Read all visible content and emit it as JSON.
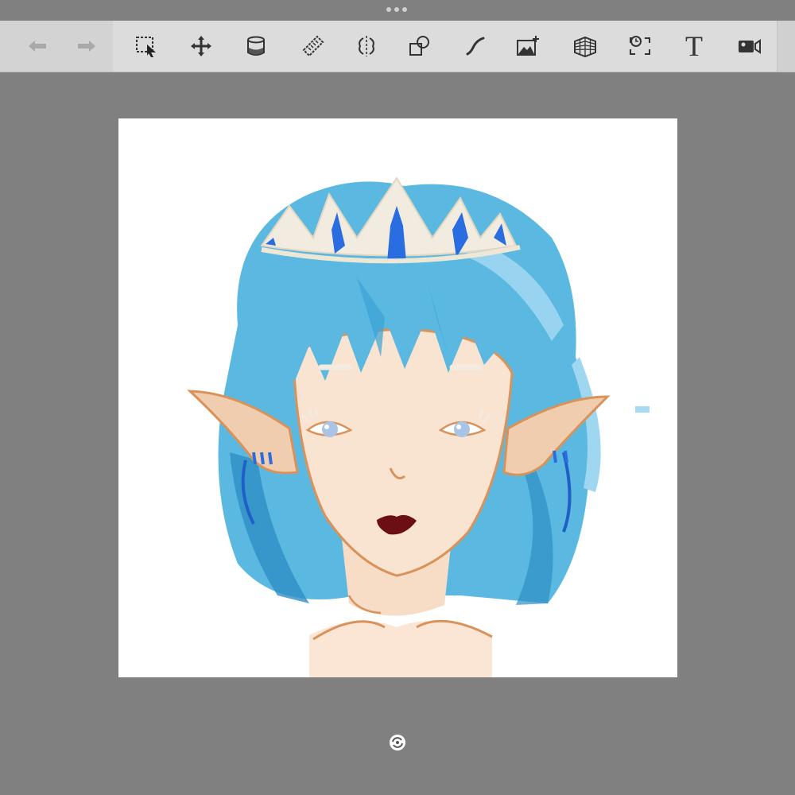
{
  "toolbar": {
    "tools": [
      {
        "name": "undo-icon"
      },
      {
        "name": "redo-icon"
      },
      {
        "name": "selection-icon"
      },
      {
        "name": "transform-icon"
      },
      {
        "name": "fill-bucket-icon"
      },
      {
        "name": "ruler-icon"
      },
      {
        "name": "symmetry-icon"
      },
      {
        "name": "shapes-icon"
      },
      {
        "name": "curve-icon"
      },
      {
        "name": "insert-image-icon"
      },
      {
        "name": "perspective-guide-icon"
      },
      {
        "name": "timelapse-icon"
      },
      {
        "name": "text-icon"
      },
      {
        "name": "record-video-icon"
      }
    ],
    "text_tool_glyph": "T"
  },
  "canvas": {
    "background": "#ffffff",
    "artwork": "elf-girl-portrait-icon",
    "colors": {
      "hair": "#5bb8e0",
      "hair_dark": "#2f8fc4",
      "skin": "#f7dcc6",
      "skin_outline": "#d9925a",
      "crown": "#f2ece0",
      "crown_gem": "#2a6de0",
      "lips": "#6b0f12",
      "eyes": "#a9c4e6"
    }
  },
  "workspace": {
    "background": "#808080"
  }
}
